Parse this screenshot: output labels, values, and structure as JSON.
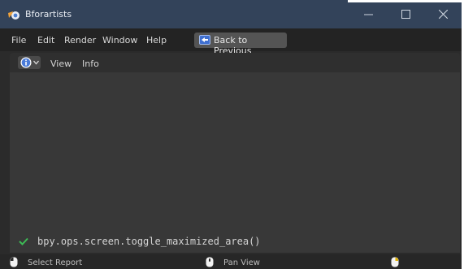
{
  "window": {
    "title": "Bforartists",
    "controls": {
      "minimize": "minimize-icon",
      "maximize": "maximize-icon",
      "close": "close-icon"
    }
  },
  "menubar": {
    "items": [
      "File",
      "Edit",
      "Render",
      "Window",
      "Help"
    ],
    "back_button": "Back to Previous"
  },
  "area_header": {
    "editor_type_icon": "info-icon",
    "items": [
      "View",
      "Info"
    ]
  },
  "report": {
    "icon": "check-icon",
    "text": "bpy.ops.screen.toggle_maximized_area()"
  },
  "statusbar": {
    "items": [
      {
        "icon": "mouse-left-icon",
        "label": "Select Report"
      },
      {
        "icon": "mouse-middle-icon",
        "label": "Pan View"
      },
      {
        "icon": "mouse-right-icon",
        "label": ""
      }
    ]
  },
  "colors": {
    "titlebar": "#33435a",
    "accent_info": "#4a7bd8",
    "success": "#3dbb55"
  }
}
